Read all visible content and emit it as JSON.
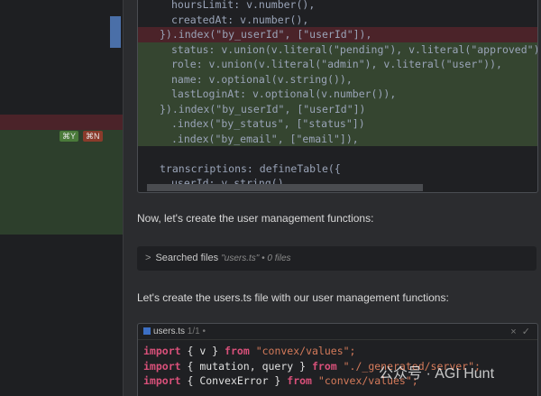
{
  "left_pane": {
    "accept_shortcut": "⌘Y",
    "reject_shortcut": "⌘N"
  },
  "code_block": {
    "lines": [
      "hoursLimit: v.number(),",
      "createdAt: v.number(),",
      "}).index(\"by_userId\", [\"userId\"]),",
      "status: v.union(v.literal(\"pending\"), v.literal(\"approved\"), v",
      "role: v.union(v.literal(\"admin\"), v.literal(\"user\")),",
      "name: v.optional(v.string()),",
      "lastLoginAt: v.optional(v.number()),",
      "}).index(\"by_userId\", [\"userId\"])",
      ".index(\"by_status\", [\"status\"])",
      ".index(\"by_email\", [\"email\"]),",
      "",
      "transcriptions: defineTable({",
      "userId: v.string(),"
    ]
  },
  "messages": {
    "m1": "Now, let's create the user management functions:",
    "m2": "Let's create the users.ts file with our user management functions:"
  },
  "search": {
    "label": "Searched files",
    "query": "\"users.ts\" • 0 files"
  },
  "file_edit": {
    "filename": "users.ts",
    "count": "1/1 •",
    "close": "×",
    "accept": "✓",
    "lines": [
      [
        "import",
        "{ v }",
        "from",
        "\"convex/values\";"
      ],
      [
        "import",
        "{ mutation, query }",
        "from",
        "\"./_generated/server\";"
      ],
      [
        "import",
        "{ ConvexError }",
        "from",
        "\"convex/values\";"
      ]
    ]
  },
  "watermark": "公众号 · AGI Hunt"
}
